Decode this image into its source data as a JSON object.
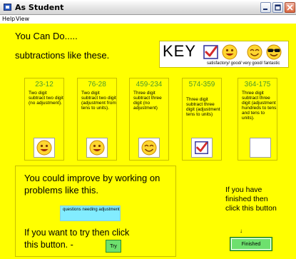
{
  "window": {
    "title": "As Student",
    "controls": {
      "minimize": "minimize-icon",
      "maximize": "maximize-icon",
      "close": "close-icon"
    }
  },
  "menu": {
    "items": [
      "Help",
      "View"
    ]
  },
  "header": {
    "line1": "You Can Do.....",
    "line2": "subtractions like these."
  },
  "key": {
    "label": "KEY",
    "description": "satisfactory/ good/ very good/ fantastic",
    "icons": [
      "checkmark-icon",
      "smiley-good-icon",
      "smiley-very-good-icon",
      "smiley-fantastic-icon"
    ]
  },
  "problems": [
    {
      "title": "23-12",
      "description": "Two digit subtract two digit (no adjustment).",
      "result_icon": "smiley-good-icon"
    },
    {
      "title": "76-28",
      "description": "Two digit subtract two digit (adjustment from tens to units).",
      "result_icon": "smiley-good-icon"
    },
    {
      "title": "459-234",
      "description": "Three digit subtract three digit (no adjustment)",
      "result_icon": "smiley-very-good-icon"
    },
    {
      "title": "574-359",
      "description": "Three digit subtract three digit (adjustment tens to units)",
      "result_icon": "checkmark-icon"
    },
    {
      "title": "364-175",
      "description": "Three digit subtract three digit (adjustment hundreds to tens and tens to units).",
      "result_icon": ""
    }
  ],
  "improve": {
    "text": "You could improve by working on problems like this.",
    "needing_label": "questions needing adjustment",
    "try_text": "If you want to try then click this button. -",
    "try_button": "Try"
  },
  "finish": {
    "text": "If you have finished then click this button",
    "arrow": "↓",
    "button": "Finished"
  },
  "colors": {
    "background": "#ffff00",
    "problem_title": "#4e9a2a",
    "button_green": "#6ee06e",
    "needing_box": "#82ecff"
  }
}
